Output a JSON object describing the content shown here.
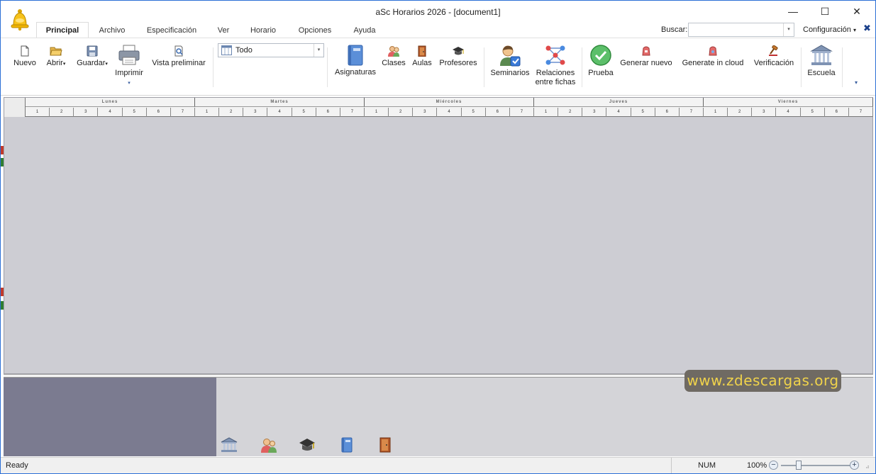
{
  "window": {
    "title": "aSc Horarios 2026  - [document1]",
    "minimize": "—",
    "maximize": "☐",
    "close": "✕"
  },
  "tabs": [
    {
      "label": "Principal",
      "active": true
    },
    {
      "label": "Archivo"
    },
    {
      "label": "Especificación"
    },
    {
      "label": "Ver"
    },
    {
      "label": "Horario"
    },
    {
      "label": "Opciones"
    },
    {
      "label": "Ayuda"
    }
  ],
  "search": {
    "label": "Buscar:",
    "value": "",
    "drop": "▾"
  },
  "config": {
    "label": "Configuración",
    "arrow": "▾",
    "close": "✖"
  },
  "ribbon": {
    "nuevo": "Nuevo",
    "abrir": "Abrir",
    "guardar": "Guardar",
    "imprimir": "Imprimir",
    "vista": "Vista preliminar",
    "filter_value": "Todo",
    "filter_drop": "▾",
    "asignaturas": "Asignaturas",
    "clases": "Clases",
    "aulas": "Aulas",
    "profesores": "Profesores",
    "seminarios": "Seminarios",
    "relaciones_1": "Relaciones",
    "relaciones_2": "entre fichas",
    "prueba": "Prueba",
    "generar": "Generar nuevo",
    "cloud": "Generate in cloud",
    "verificacion": "Verificación",
    "escuela": "Escuela",
    "more": "▾",
    "dropmark": "▾"
  },
  "timetable": {
    "days": [
      "Lunes",
      "Martes",
      "Miércoles",
      "Jueves",
      "Viernes"
    ],
    "periods": [
      "1",
      "2",
      "3",
      "4",
      "5",
      "6",
      "7"
    ]
  },
  "watermark": "www.zdescargas.org",
  "status": {
    "text": "Ready",
    "num": "NUM",
    "zoom": "100%",
    "zoom_level_percent": 100,
    "minus": "−",
    "plus": "+",
    "grip": "⣠"
  },
  "colors": {
    "accent": "#2b6fd6",
    "grid_bg": "#cdcdd3",
    "left_panel": "#7b7b90",
    "watermark_text": "#f0d34b"
  }
}
